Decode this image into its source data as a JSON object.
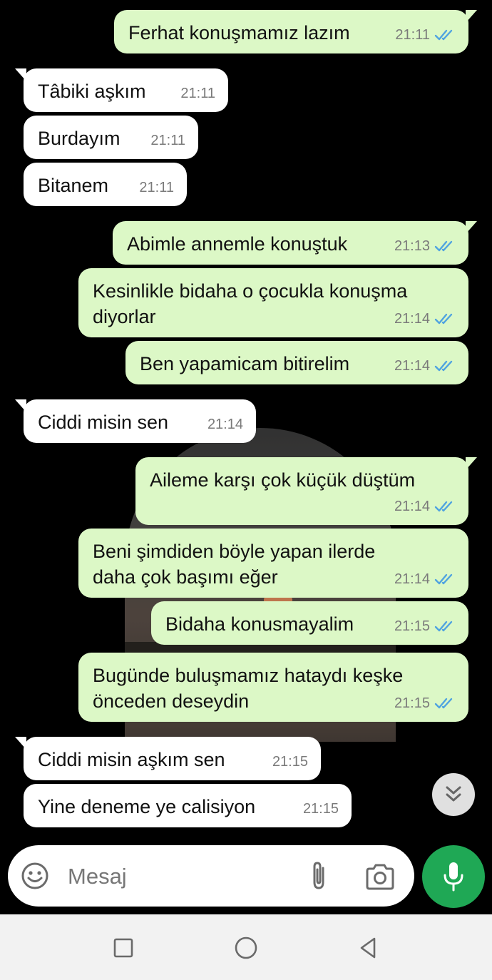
{
  "messages": [
    {
      "dir": "out",
      "text": "Ferhat konuşmamız lazım",
      "time": "21:11"
    },
    {
      "dir": "in",
      "text": "Tâbiki aşkım",
      "time": "21:11"
    },
    {
      "dir": "in",
      "text": "Burdayım",
      "time": "21:11"
    },
    {
      "dir": "in",
      "text": "Bitanem",
      "time": "21:11"
    },
    {
      "dir": "out",
      "text": "Abimle annemle konuştuk",
      "time": "21:13"
    },
    {
      "dir": "out",
      "text": "Kesinlikle bidaha o çocukla konuşma\ndiyorlar",
      "time": "21:14"
    },
    {
      "dir": "out",
      "text": "Ben yapamicam bitirelim",
      "time": "21:14"
    },
    {
      "dir": "in",
      "text": "Ciddi misin sen",
      "time": "21:14"
    },
    {
      "dir": "out",
      "text": "Aileme karşı çok küçük düştüm",
      "time": "21:14"
    },
    {
      "dir": "out",
      "text": "Beni şimdiden böyle yapan ilerde\ndaha çok başımı eğer",
      "time": "21:14"
    },
    {
      "dir": "out",
      "text": "Bidaha konusmayalim",
      "time": "21:15"
    },
    {
      "dir": "out",
      "text": "Bugünde buluşmamız hataydı keşke\nönceden deseydin",
      "time": "21:15"
    },
    {
      "dir": "in",
      "text": "Ciddi misin aşkım sen",
      "time": "21:15"
    },
    {
      "dir": "in",
      "text": "Yine deneme ye calisiyon",
      "time": "21:15"
    }
  ],
  "composer": {
    "placeholder": "Mesaj",
    "emoji_icon": "emoji-icon",
    "attach_icon": "paperclip-icon",
    "camera_icon": "camera-icon",
    "mic_icon": "microphone-icon"
  },
  "colors": {
    "outgoing_bubble": "#dcf8c6",
    "incoming_bubble": "#ffffff",
    "read_ticks": "#4fa3e0",
    "mic_button": "#1fa855"
  },
  "nav": [
    "recent-apps-icon",
    "home-icon",
    "back-icon"
  ]
}
